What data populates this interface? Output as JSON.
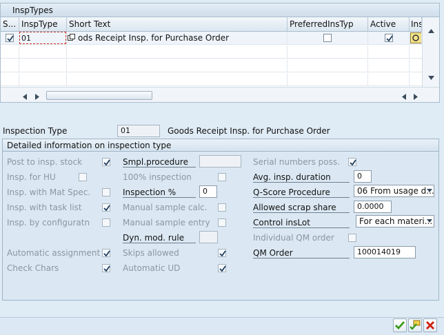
{
  "table": {
    "title": "InspTypes",
    "columns": [
      "S...",
      "InspType",
      "Short Text",
      "PreferredInsTyp",
      "Active",
      "Ins"
    ],
    "rows": [
      {
        "insp_type": "01",
        "short_text": "Goods Receipt Insp. for Purchase Order",
        "short_text_visible": "ods Receipt Insp. for Purchase Order",
        "preferred": false,
        "active": true,
        "selected": true
      }
    ]
  },
  "inspection_type": {
    "label": "Inspection Type",
    "value": "01",
    "description": "Goods Receipt Insp. for Purchase Order"
  },
  "details": {
    "title": "Detailed information on inspection type",
    "col1": [
      {
        "label": "Post to insp. stock",
        "checked": true
      },
      {
        "label": "Insp. for HU",
        "checked": false
      },
      {
        "label": "Insp. with Mat Spec.",
        "checked": false
      },
      {
        "label": "Insp. with task list",
        "checked": true
      },
      {
        "label": "Insp. by configuratn",
        "checked": false
      },
      {
        "label": "Automatic assignment",
        "checked": true
      },
      {
        "label": "Check Chars",
        "checked": true
      }
    ],
    "col2": {
      "smpl_procedure": {
        "label": "Smpl.procedure",
        "value": ""
      },
      "hundred_pct": {
        "label": "100% inspection",
        "checked": false
      },
      "inspection_pct": {
        "label": "Inspection %",
        "value": "0"
      },
      "manual_sample_calc": {
        "label": "Manual sample calc.",
        "checked": false
      },
      "manual_sample_entry": {
        "label": "Manual sample entry",
        "checked": false
      },
      "dyn_mod_rule": {
        "label": "Dyn. mod. rule",
        "value": ""
      },
      "skips_allowed": {
        "label": "Skips allowed",
        "checked": true
      },
      "automatic_ud": {
        "label": "Automatic UD",
        "checked": true
      }
    },
    "col3": {
      "serial_numbers": {
        "label": "Serial numbers poss.",
        "checked": true
      },
      "avg_duration": {
        "label": "Avg. insp. duration",
        "value": "0"
      },
      "qscore": {
        "label": "Q-Score Procedure",
        "value": "06 From usage d..."
      },
      "scrap_share": {
        "label": "Allowed scrap share",
        "value": "0.0000"
      },
      "control_inslot": {
        "label": "Control insLot",
        "value": "For each materi..."
      },
      "individual_qm": {
        "label": "Individual QM order",
        "checked": false
      },
      "qm_order": {
        "label": "QM Order",
        "value": "100014019"
      }
    }
  },
  "colors": {
    "accent": "#dfebf5",
    "check": "#1c3c5c",
    "ok": "#3a9a1a",
    "cancel": "#d02010"
  },
  "icons": [
    "checkmark-icon",
    "new-entries-icon",
    "cancel-icon",
    "column-settings-icon",
    "search-help-icon",
    "scroll-left-icon",
    "scroll-right-icon",
    "scroll-up-icon",
    "scroll-down-icon"
  ]
}
